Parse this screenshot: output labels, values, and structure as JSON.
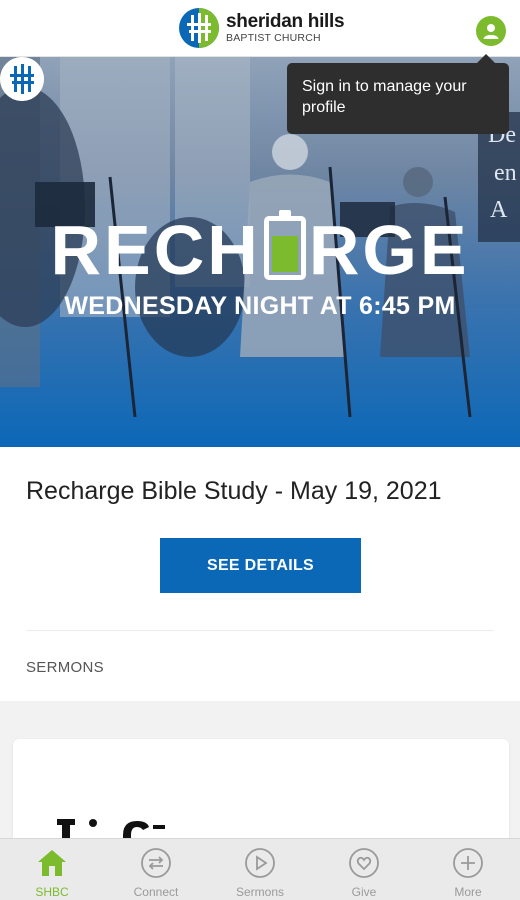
{
  "header": {
    "brand_name": "sheridan hills",
    "brand_sub": "BAPTIST CHURCH",
    "profile_tooltip": "Sign in to manage your profile"
  },
  "hero": {
    "title_left": "RECH",
    "title_right": "RGE",
    "subtitle": "WEDNESDAY NIGHT AT 6:45 PM",
    "side_text": [
      "De",
      "en",
      "A"
    ]
  },
  "main": {
    "event_title": "Recharge Bible Study - May 19, 2021",
    "details_button": "SEE DETAILS",
    "section_label": "SERMONS"
  },
  "tabs": [
    {
      "label": "SHBC",
      "icon": "home-icon",
      "active": true
    },
    {
      "label": "Connect",
      "icon": "connect-arrows-icon",
      "active": false
    },
    {
      "label": "Sermons",
      "icon": "play-icon",
      "active": false
    },
    {
      "label": "Give",
      "icon": "heart-icon",
      "active": false
    },
    {
      "label": "More",
      "icon": "plus-icon",
      "active": false
    }
  ],
  "colors": {
    "brand_green": "#7dbb2e",
    "brand_blue": "#0a68b7",
    "tooltip_bg": "#2e2e2e",
    "tab_inactive": "#9a9a9a"
  }
}
